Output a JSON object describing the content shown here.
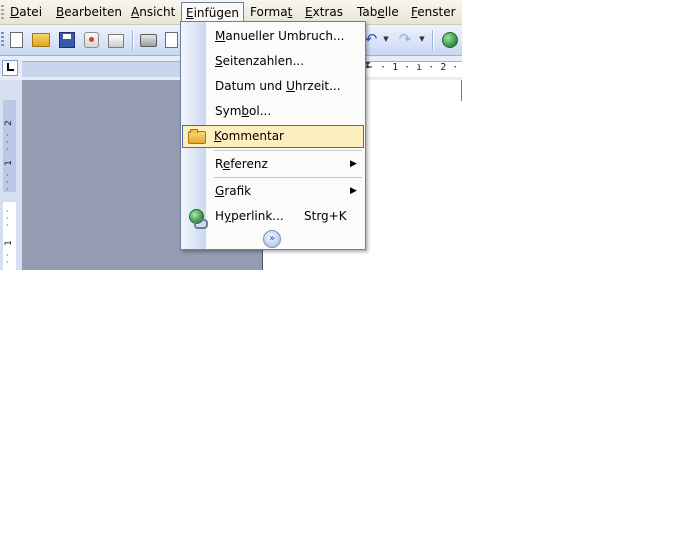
{
  "menubar": {
    "items": [
      {
        "label": "Datei",
        "accel": "D",
        "rest": "atei",
        "pre": ""
      },
      {
        "label": "Bearbeiten",
        "accel": "B",
        "rest": "earbeiten",
        "pre": ""
      },
      {
        "label": "Ansicht",
        "accel": "A",
        "rest": "nsicht",
        "pre": ""
      },
      {
        "label": "Einfügen",
        "accel": "E",
        "rest": "infügen",
        "pre": ""
      },
      {
        "label": "Format",
        "pre": "Forma",
        "accel": "t",
        "rest": ""
      },
      {
        "label": "Extras",
        "accel": "E",
        "rest": "xtras",
        "pre": ""
      },
      {
        "label": "Tabelle",
        "pre": "Tab",
        "accel": "e",
        "rest": "lle"
      },
      {
        "label": "Fenster",
        "accel": "F",
        "rest": "enster",
        "pre": ""
      }
    ],
    "active_index": 3
  },
  "toolbar": {
    "icons": [
      "new-document-icon",
      "open-folder-icon",
      "save-icon",
      "permission-icon",
      "email-icon",
      "print-icon",
      "print-preview-icon",
      "undo-icon",
      "redo-icon",
      "research-globe-icon"
    ]
  },
  "ruler": {
    "ticks": "· · 1 · ı · 2 ·"
  },
  "vruler": {
    "label_2": "2",
    "label_1": "1",
    "label_1b": "1"
  },
  "menu": {
    "items": [
      {
        "label": "Manueller Umbruch...",
        "pre": "",
        "accel": "M",
        "rest": "anueller Umbruch..."
      },
      {
        "label": "Seitenzahlen...",
        "pre": "",
        "accel": "S",
        "rest": "eitenzahlen..."
      },
      {
        "label": "Datum und Uhrzeit...",
        "pre": "Datum und ",
        "accel": "U",
        "rest": "hrzeit..."
      },
      {
        "label": "Symbol...",
        "pre": "Sym",
        "accel": "b",
        "rest": "ol..."
      },
      {
        "label": "Kommentar",
        "pre": "",
        "accel": "K",
        "rest": "ommentar",
        "icon": "folder-icon",
        "highlighted": true
      },
      {
        "label": "Referenz",
        "pre": "R",
        "accel": "e",
        "rest": "ferenz",
        "submenu": true
      },
      {
        "label": "Grafik",
        "pre": "",
        "accel": "G",
        "rest": "rafik",
        "submenu": true
      },
      {
        "label": "Hyperlink...",
        "pre": "H",
        "accel": "y",
        "rest": "perlink...",
        "shortcut": "Strg+K",
        "icon": "hyperlink-icon"
      }
    ],
    "expand_glyph": "»",
    "submenu_arrow": "▶"
  },
  "colors": {
    "menu_highlight": "#fdeebe",
    "menu_highlight_border": "#4c6aa8",
    "toolbar_gradient_top": "#eef3fc",
    "toolbar_gradient_bottom": "#c8d8f2",
    "doc_background": "#959cb2"
  }
}
